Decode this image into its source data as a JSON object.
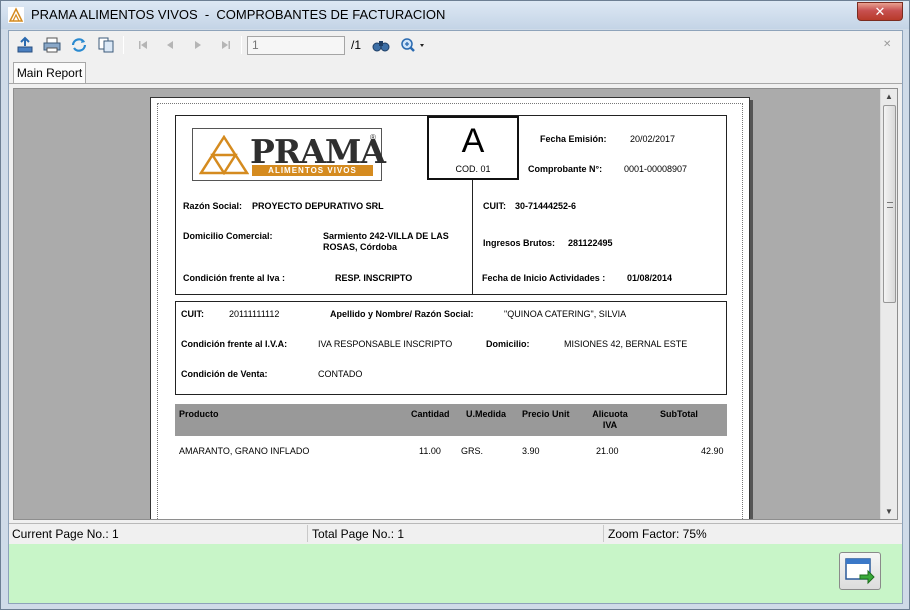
{
  "window": {
    "title": "PRAMA ALIMENTOS VIVOS  -  COMPROBANTES DE FACTURACION",
    "close_label": "✕"
  },
  "toolbar": {
    "buttons": [
      "export-icon",
      "print-icon",
      "refresh-icon",
      "copy-icon",
      "first-page-icon",
      "prev-page-icon",
      "next-page-icon",
      "last-page-icon",
      "search-binoculars-icon",
      "zoom-icon"
    ],
    "page_value": "1",
    "page_total": "/1"
  },
  "tabs": [
    {
      "label": "Main Report"
    }
  ],
  "report": {
    "logo": {
      "word": "PRAMA",
      "sub": "ALIMENTOS VIVOS",
      "reg": "®"
    },
    "invoice_letter": "A",
    "invoice_code": "COD. 01",
    "fecha_emision_label": "Fecha Emisión:",
    "fecha_emision_value": "20/02/2017",
    "comprobante_label": "Comprobante N°:",
    "comprobante_value": "0001-00008907",
    "razon_social_label": "Razón Social:",
    "razon_social_value": "PROYECTO DEPURATIVO SRL",
    "domicilio_comercial_label": "Domicilio Comercial:",
    "domicilio_comercial_value": "Sarmiento  242-VILLA  DE LAS ROSAS, Córdoba",
    "condicion_iva_label": "Condición frente al Iva :",
    "condicion_iva_value": "RESP.  INSCRIPTO",
    "cuit_label": "CUIT:",
    "cuit_value": "30-71444252-6",
    "ingresos_brutos_label": "Ingresos Brutos:",
    "ingresos_brutos_value": "281122495",
    "inicio_actividades_label": "Fecha de Inicio Actividades :",
    "inicio_actividades_value": "01/08/2014",
    "client": {
      "cuit_label": "CUIT:",
      "cuit_value": "20111111112",
      "nombre_label": "Apellido y Nombre/ Razón Social:",
      "nombre_value": "\"QUINOA CATERING\", SILVIA",
      "cond_iva_label": "Condición frente al I.V.A:",
      "cond_iva_value": "IVA RESPONSABLE INSCRIPTO",
      "domicilio_label": "Domicilio:",
      "domicilio_value": "MISIONES 42, BERNAL ESTE",
      "cond_venta_label": "Condición de Venta:",
      "cond_venta_value": "CONTADO"
    },
    "table": {
      "headers": [
        "Producto",
        "Cantidad",
        "U.Medida",
        "Precio Unit",
        "Alicuota IVA",
        "SubTotal"
      ],
      "rows": [
        [
          "AMARANTO, GRANO INFLADO",
          "11.00",
          "GRS.",
          "3.90",
          "21.00",
          "42.90"
        ]
      ]
    }
  },
  "status": {
    "current_page": "Current Page No.: 1",
    "total_page": "Total Page No.: 1",
    "zoom": "Zoom Factor: 75%"
  },
  "colors": {
    "footer": "#c8f5c8",
    "logo_orange": "#d58b1f",
    "close": "#c75050"
  }
}
